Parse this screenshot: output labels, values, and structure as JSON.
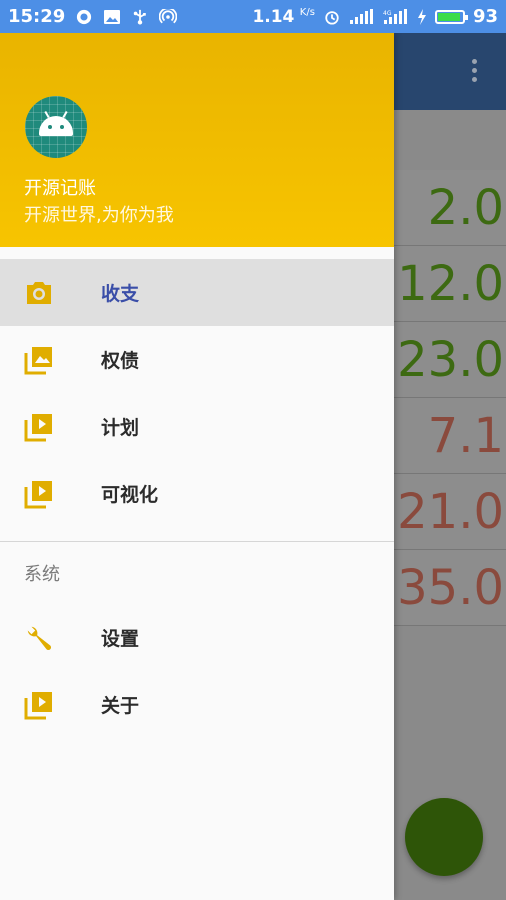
{
  "status_bar": {
    "time": "15:29",
    "net_speed_value": "1.14",
    "net_speed_unit": "K/s",
    "battery_percent": "93",
    "battery_level": 0.93,
    "icons": [
      "chrome-like-icon",
      "gallery-icon",
      "usb-icon",
      "hotspot-icon",
      "alarm-icon",
      "signal-icon",
      "4g-signal-icon",
      "charging-icon",
      "battery-icon"
    ]
  },
  "drawer": {
    "header": {
      "title": "开源记账",
      "subtitle": "开源世界,为你为我",
      "avatar_icon": "android-icon"
    },
    "items": [
      {
        "label": "收支",
        "icon": "camera-icon",
        "active": true
      },
      {
        "label": "权债",
        "icon": "gallery-icon",
        "active": false
      },
      {
        "label": "计划",
        "icon": "video-library-icon",
        "active": false
      },
      {
        "label": "可视化",
        "icon": "video-library-icon",
        "active": false
      }
    ],
    "section_title": "系统",
    "system_items": [
      {
        "label": "设置",
        "icon": "wrench-icon"
      },
      {
        "label": "关于",
        "icon": "video-library-icon"
      }
    ]
  },
  "background": {
    "toolbar_icon": "more-vert-icon",
    "values": [
      {
        "text": "2.0",
        "type": "income"
      },
      {
        "text": "12.0",
        "type": "income"
      },
      {
        "text": "23.0",
        "type": "income"
      },
      {
        "text": "7.1",
        "type": "expense"
      },
      {
        "text": "21.0",
        "type": "expense"
      },
      {
        "text": "35.0",
        "type": "expense"
      }
    ],
    "fab_icon": "add-icon"
  },
  "colors": {
    "accent": "#f2bd00",
    "active_text": "#3a4ea8",
    "icon_color": "#e0ad00",
    "income": "#3d6a12",
    "expense": "#8a4a3d"
  }
}
